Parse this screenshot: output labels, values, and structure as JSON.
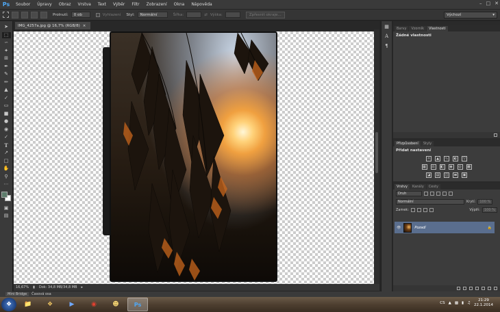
{
  "menu": {
    "app_logo": "Ps",
    "items": [
      "Soubor",
      "Úpravy",
      "Obraz",
      "Vrstva",
      "Text",
      "Výběr",
      "Filtr",
      "Zobrazení",
      "Okna",
      "Nápověda"
    ]
  },
  "options": {
    "feather_label": "Prolnutí:",
    "feather_value": "0 ob",
    "antialias_label": "Vyhlazení",
    "style_label": "Styl:",
    "style_value": "Normální",
    "width_label": "Šířka:",
    "height_label": "Výška:",
    "refine_label": "Zpřesnit okraje...",
    "workspace_value": "Výchozí"
  },
  "document": {
    "tab_title": "IMG_4257a.jpg @ 16,7% (RGB/8)",
    "zoom": "16,67%",
    "doc_size": "Dok: 34,8 MB/34,8 MB"
  },
  "bridge": {
    "tabs": [
      "Mini Bridge",
      "Časová osa"
    ]
  },
  "panels": {
    "top": {
      "tabs": [
        "Barvy",
        "Vzorník",
        "Vlastnosti"
      ],
      "active_tab": 2,
      "title": "Žádné vlastnosti"
    },
    "adjustments": {
      "tabs": [
        "Přizpůsobení",
        "Styly"
      ],
      "active_tab": 0,
      "title": "Přidat nastavení"
    },
    "layers": {
      "tabs": [
        "Vrstvy",
        "Kanály",
        "Cesty"
      ],
      "active_tab": 0,
      "filter_value": "Druh",
      "blend_mode": "Normální",
      "opacity_label": "Krytí:",
      "opacity_value": "100 %",
      "lock_label": "Zamek:",
      "fill_label": "Výplň:",
      "fill_value": "100 %",
      "layer_name": "Pozadí"
    }
  },
  "taskbar": {
    "language": "CS",
    "time": "21:29",
    "date": "22.1.2014"
  }
}
